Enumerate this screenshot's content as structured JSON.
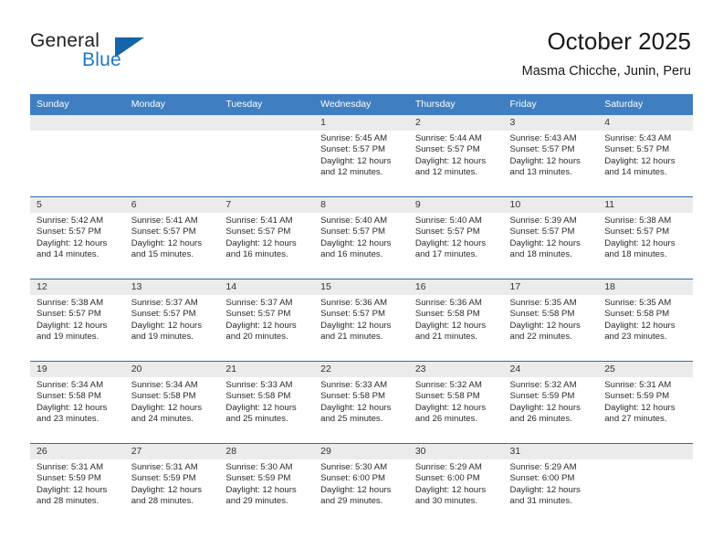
{
  "logo": {
    "word_one": "General",
    "word_two": "Blue",
    "triangle": "triangle-shape"
  },
  "header": {
    "month_title": "October 2025",
    "location": "Masma Chicche, Junin, Peru"
  },
  "calendar": {
    "weekday_headers": [
      "Sunday",
      "Monday",
      "Tuesday",
      "Wednesday",
      "Thursday",
      "Friday",
      "Saturday"
    ],
    "accent_color": "#3f7fc1",
    "separator_color": "#2e6ca8",
    "daynum_band_color": "#ebebeb",
    "weeks": [
      [
        {
          "day": "",
          "lines": []
        },
        {
          "day": "",
          "lines": []
        },
        {
          "day": "",
          "lines": []
        },
        {
          "day": "1",
          "lines": [
            "Sunrise: 5:45 AM",
            "Sunset: 5:57 PM",
            "Daylight: 12 hours",
            "and 12 minutes."
          ]
        },
        {
          "day": "2",
          "lines": [
            "Sunrise: 5:44 AM",
            "Sunset: 5:57 PM",
            "Daylight: 12 hours",
            "and 12 minutes."
          ]
        },
        {
          "day": "3",
          "lines": [
            "Sunrise: 5:43 AM",
            "Sunset: 5:57 PM",
            "Daylight: 12 hours",
            "and 13 minutes."
          ]
        },
        {
          "day": "4",
          "lines": [
            "Sunrise: 5:43 AM",
            "Sunset: 5:57 PM",
            "Daylight: 12 hours",
            "and 14 minutes."
          ]
        }
      ],
      [
        {
          "day": "5",
          "lines": [
            "Sunrise: 5:42 AM",
            "Sunset: 5:57 PM",
            "Daylight: 12 hours",
            "and 14 minutes."
          ]
        },
        {
          "day": "6",
          "lines": [
            "Sunrise: 5:41 AM",
            "Sunset: 5:57 PM",
            "Daylight: 12 hours",
            "and 15 minutes."
          ]
        },
        {
          "day": "7",
          "lines": [
            "Sunrise: 5:41 AM",
            "Sunset: 5:57 PM",
            "Daylight: 12 hours",
            "and 16 minutes."
          ]
        },
        {
          "day": "8",
          "lines": [
            "Sunrise: 5:40 AM",
            "Sunset: 5:57 PM",
            "Daylight: 12 hours",
            "and 16 minutes."
          ]
        },
        {
          "day": "9",
          "lines": [
            "Sunrise: 5:40 AM",
            "Sunset: 5:57 PM",
            "Daylight: 12 hours",
            "and 17 minutes."
          ]
        },
        {
          "day": "10",
          "lines": [
            "Sunrise: 5:39 AM",
            "Sunset: 5:57 PM",
            "Daylight: 12 hours",
            "and 18 minutes."
          ]
        },
        {
          "day": "11",
          "lines": [
            "Sunrise: 5:38 AM",
            "Sunset: 5:57 PM",
            "Daylight: 12 hours",
            "and 18 minutes."
          ]
        }
      ],
      [
        {
          "day": "12",
          "lines": [
            "Sunrise: 5:38 AM",
            "Sunset: 5:57 PM",
            "Daylight: 12 hours",
            "and 19 minutes."
          ]
        },
        {
          "day": "13",
          "lines": [
            "Sunrise: 5:37 AM",
            "Sunset: 5:57 PM",
            "Daylight: 12 hours",
            "and 19 minutes."
          ]
        },
        {
          "day": "14",
          "lines": [
            "Sunrise: 5:37 AM",
            "Sunset: 5:57 PM",
            "Daylight: 12 hours",
            "and 20 minutes."
          ]
        },
        {
          "day": "15",
          "lines": [
            "Sunrise: 5:36 AM",
            "Sunset: 5:57 PM",
            "Daylight: 12 hours",
            "and 21 minutes."
          ]
        },
        {
          "day": "16",
          "lines": [
            "Sunrise: 5:36 AM",
            "Sunset: 5:58 PM",
            "Daylight: 12 hours",
            "and 21 minutes."
          ]
        },
        {
          "day": "17",
          "lines": [
            "Sunrise: 5:35 AM",
            "Sunset: 5:58 PM",
            "Daylight: 12 hours",
            "and 22 minutes."
          ]
        },
        {
          "day": "18",
          "lines": [
            "Sunrise: 5:35 AM",
            "Sunset: 5:58 PM",
            "Daylight: 12 hours",
            "and 23 minutes."
          ]
        }
      ],
      [
        {
          "day": "19",
          "lines": [
            "Sunrise: 5:34 AM",
            "Sunset: 5:58 PM",
            "Daylight: 12 hours",
            "and 23 minutes."
          ]
        },
        {
          "day": "20",
          "lines": [
            "Sunrise: 5:34 AM",
            "Sunset: 5:58 PM",
            "Daylight: 12 hours",
            "and 24 minutes."
          ]
        },
        {
          "day": "21",
          "lines": [
            "Sunrise: 5:33 AM",
            "Sunset: 5:58 PM",
            "Daylight: 12 hours",
            "and 25 minutes."
          ]
        },
        {
          "day": "22",
          "lines": [
            "Sunrise: 5:33 AM",
            "Sunset: 5:58 PM",
            "Daylight: 12 hours",
            "and 25 minutes."
          ]
        },
        {
          "day": "23",
          "lines": [
            "Sunrise: 5:32 AM",
            "Sunset: 5:58 PM",
            "Daylight: 12 hours",
            "and 26 minutes."
          ]
        },
        {
          "day": "24",
          "lines": [
            "Sunrise: 5:32 AM",
            "Sunset: 5:59 PM",
            "Daylight: 12 hours",
            "and 26 minutes."
          ]
        },
        {
          "day": "25",
          "lines": [
            "Sunrise: 5:31 AM",
            "Sunset: 5:59 PM",
            "Daylight: 12 hours",
            "and 27 minutes."
          ]
        }
      ],
      [
        {
          "day": "26",
          "lines": [
            "Sunrise: 5:31 AM",
            "Sunset: 5:59 PM",
            "Daylight: 12 hours",
            "and 28 minutes."
          ]
        },
        {
          "day": "27",
          "lines": [
            "Sunrise: 5:31 AM",
            "Sunset: 5:59 PM",
            "Daylight: 12 hours",
            "and 28 minutes."
          ]
        },
        {
          "day": "28",
          "lines": [
            "Sunrise: 5:30 AM",
            "Sunset: 5:59 PM",
            "Daylight: 12 hours",
            "and 29 minutes."
          ]
        },
        {
          "day": "29",
          "lines": [
            "Sunrise: 5:30 AM",
            "Sunset: 6:00 PM",
            "Daylight: 12 hours",
            "and 29 minutes."
          ]
        },
        {
          "day": "30",
          "lines": [
            "Sunrise: 5:29 AM",
            "Sunset: 6:00 PM",
            "Daylight: 12 hours",
            "and 30 minutes."
          ]
        },
        {
          "day": "31",
          "lines": [
            "Sunrise: 5:29 AM",
            "Sunset: 6:00 PM",
            "Daylight: 12 hours",
            "and 31 minutes."
          ]
        },
        {
          "day": "",
          "lines": []
        }
      ]
    ]
  }
}
